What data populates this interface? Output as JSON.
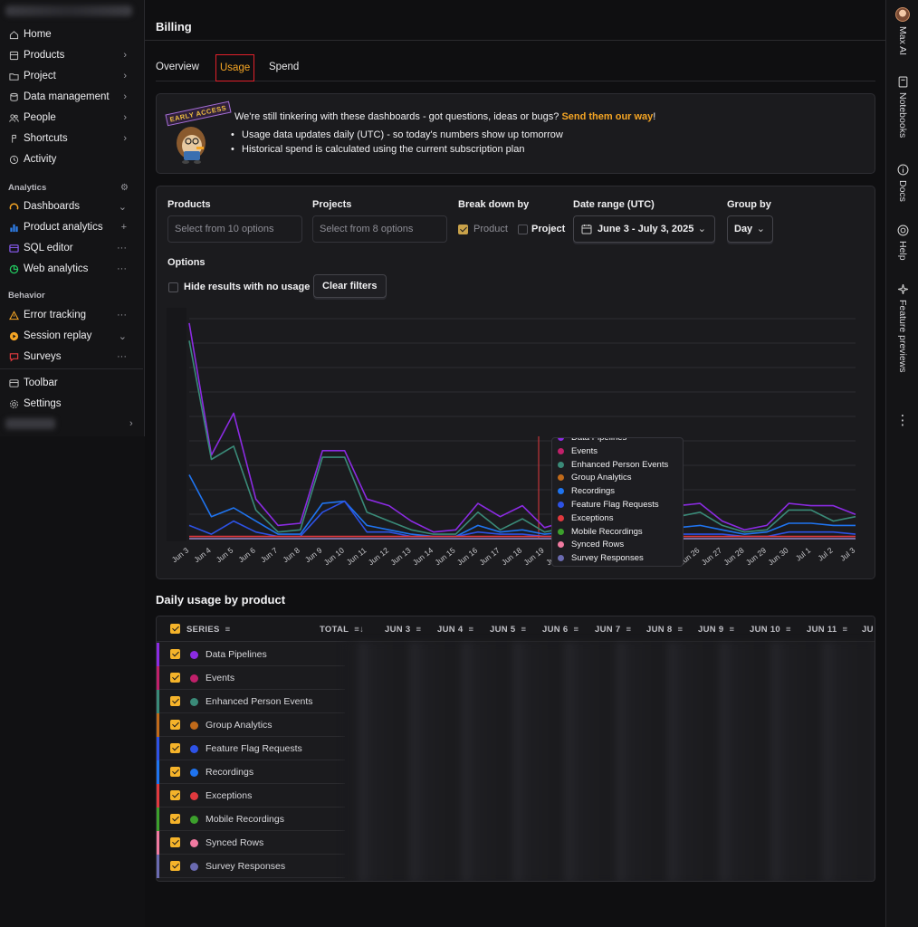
{
  "sidebar": {
    "items": [
      {
        "label": "Home"
      },
      {
        "label": "Products",
        "trail": "›"
      },
      {
        "label": "Project",
        "trail": "›"
      },
      {
        "label": "Data management",
        "trail": "›"
      },
      {
        "label": "People",
        "trail": "›"
      },
      {
        "label": "Shortcuts",
        "trail": "›"
      },
      {
        "label": "Activity"
      }
    ],
    "analytics_label": "Analytics",
    "analytics": [
      {
        "label": "Dashboards",
        "trail": "⌄"
      },
      {
        "label": "Product analytics",
        "trail": "+"
      },
      {
        "label": "SQL editor",
        "trail": "···"
      },
      {
        "label": "Web analytics",
        "trail": "···"
      }
    ],
    "behavior_label": "Behavior",
    "behavior": [
      {
        "label": "Error tracking",
        "trail": "···"
      },
      {
        "label": "Session replay",
        "trail": "⌄"
      },
      {
        "label": "Surveys",
        "trail": "···"
      }
    ],
    "bottom": [
      {
        "label": "Toolbar"
      },
      {
        "label": "Settings"
      }
    ],
    "user_trail": "›"
  },
  "rail": {
    "max_ai": "Max AI",
    "notebooks": "Notebooks",
    "docs": "Docs",
    "help": "Help",
    "feature_previews": "Feature previews",
    "more": "⋮"
  },
  "page": {
    "title": "Billing"
  },
  "tabs": [
    {
      "label": "Overview"
    },
    {
      "label": "Usage"
    },
    {
      "label": "Spend"
    }
  ],
  "banner": {
    "badge": "EARLY ACCESS",
    "headline": "We're still tinkering with these dashboards - got questions, ideas or bugs?",
    "link": "Send them our way",
    "after_link": "!",
    "bullets": [
      "Usage data updates daily (UTC) - so today's numbers show up tomorrow",
      "Historical spend is calculated using the current subscription plan"
    ]
  },
  "filters": {
    "products_label": "Products",
    "products_placeholder": "Select from 10 options",
    "projects_label": "Projects",
    "projects_placeholder": "Select from 8 options",
    "breakdown_label": "Break down by",
    "breakdown_product": "Product",
    "breakdown_project": "Project",
    "date_label": "Date range (UTC)",
    "date_value": "June 3 - July 3, 2025",
    "group_label": "Group by",
    "group_value": "Day",
    "options_label": "Options",
    "hide_no_usage": "Hide results with no usage",
    "clear_filters": "Clear filters"
  },
  "chart_data": {
    "type": "line",
    "categories": [
      "Jun 3",
      "Jun 4",
      "Jun 5",
      "Jun 6",
      "Jun 7",
      "Jun 8",
      "Jun 9",
      "Jun 10",
      "Jun 11",
      "Jun 12",
      "Jun 13",
      "Jun 14",
      "Jun 15",
      "Jun 16",
      "Jun 17",
      "Jun 18",
      "Jun 19",
      "Jun 20",
      "Jun 21",
      "Jun 22",
      "Jun 23",
      "Jun 24",
      "Jun 25",
      "Jun 26",
      "Jun 27",
      "Jun 28",
      "Jun 29",
      "Jun 30",
      "Jul 1",
      "Jul 2",
      "Jul 3"
    ],
    "ylim": [
      0,
      100
    ],
    "grid": true,
    "legend_position": "hover-tooltip",
    "series": [
      {
        "name": "Data Pipelines",
        "color": "#8b2be2",
        "values": [
          98,
          38,
          57,
          18,
          6,
          7,
          40,
          40,
          18,
          15,
          8,
          3,
          4,
          16,
          10,
          15,
          5,
          8,
          12,
          18,
          20,
          14,
          15,
          16,
          8,
          4,
          6,
          16,
          15,
          15,
          11
        ]
      },
      {
        "name": "Events",
        "color": "#c0206a",
        "values": [
          0,
          0,
          0,
          0,
          0,
          0,
          0,
          0,
          0,
          0,
          0,
          0,
          0,
          0,
          0,
          0,
          0,
          0,
          0,
          0,
          0,
          0,
          0,
          0,
          0,
          0,
          0,
          0,
          0,
          0,
          0
        ]
      },
      {
        "name": "Enhanced Person Events",
        "color": "#3a8a78",
        "values": [
          90,
          36,
          42,
          13,
          3,
          4,
          37,
          37,
          12,
          8,
          4,
          2,
          2,
          12,
          4,
          9,
          3,
          5,
          8,
          10,
          12,
          10,
          10,
          12,
          6,
          3,
          4,
          13,
          13,
          8,
          10
        ]
      },
      {
        "name": "Group Analytics",
        "color": "#c06a1a",
        "values": [
          0,
          0,
          0,
          0,
          0,
          0,
          0,
          0,
          0,
          0,
          0,
          0,
          0,
          0,
          0,
          0,
          0,
          0,
          0,
          0,
          0,
          0,
          0,
          0,
          0,
          0,
          0,
          0,
          0,
          0,
          0
        ]
      },
      {
        "name": "Recordings",
        "color": "#1f74f0",
        "values": [
          29,
          10,
          14,
          8,
          2,
          2,
          16,
          17,
          6,
          4,
          2,
          1,
          1,
          6,
          3,
          4,
          2,
          3,
          4,
          5,
          6,
          5,
          5,
          6,
          4,
          2,
          3,
          7,
          7,
          6,
          6
        ]
      },
      {
        "name": "Feature Flag Requests",
        "color": "#2d52e6",
        "values": [
          6,
          2,
          8,
          3,
          1,
          1,
          12,
          17,
          3,
          3,
          1,
          1,
          1,
          3,
          2,
          2,
          1,
          1,
          2,
          2,
          2,
          2,
          2,
          2,
          2,
          1,
          1,
          3,
          3,
          3,
          2
        ]
      },
      {
        "name": "Exceptions",
        "color": "#e0393e",
        "values": [
          1,
          1,
          1,
          1,
          1,
          1,
          1,
          1,
          1,
          1,
          1,
          1,
          1,
          1,
          1,
          1,
          1,
          1,
          1,
          1,
          1,
          1,
          1,
          1,
          1,
          1,
          1,
          1,
          1,
          1,
          1
        ]
      },
      {
        "name": "Mobile Recordings",
        "color": "#3ca02c",
        "values": [
          0,
          0,
          0,
          0,
          0,
          0,
          0,
          0,
          0,
          0,
          0,
          0,
          0,
          0,
          0,
          0,
          0,
          0,
          0,
          0,
          0,
          0,
          0,
          0,
          0,
          0,
          0,
          0,
          0,
          0,
          0
        ]
      },
      {
        "name": "Synced Rows",
        "color": "#f07aa0",
        "values": [
          0,
          0,
          0,
          0,
          0,
          0,
          0,
          0,
          0,
          0,
          0,
          0,
          0,
          0,
          0,
          0,
          0,
          0,
          0,
          0,
          0,
          0,
          0,
          0,
          0,
          0,
          0,
          0,
          0,
          0,
          0
        ]
      },
      {
        "name": "Survey Responses",
        "color": "#6a6ab0",
        "values": [
          0,
          0,
          0,
          0,
          0,
          0,
          0,
          0,
          0,
          0,
          0,
          0,
          0,
          0,
          0,
          0,
          0,
          0,
          0,
          0,
          0,
          0,
          0,
          0,
          0,
          0,
          0,
          0,
          0,
          0,
          0
        ]
      }
    ],
    "tooltip_items": [
      "Data Pipelines",
      "Events",
      "Enhanced Person Events",
      "Group Analytics",
      "Recordings",
      "Feature Flag Requests",
      "Exceptions",
      "Mobile Recordings",
      "Synced Rows",
      "Survey Responses"
    ]
  },
  "table": {
    "title": "Daily usage by product",
    "headers": [
      "SERIES",
      "TOTAL",
      "JUN 3",
      "JUN 4",
      "JUN 5",
      "JUN 6",
      "JUN 7",
      "JUN 8",
      "JUN 9",
      "JUN 10",
      "JUN 11",
      "JU"
    ],
    "rows": [
      {
        "label": "Data Pipelines",
        "color": "#8b2be2"
      },
      {
        "label": "Events",
        "color": "#c0206a"
      },
      {
        "label": "Enhanced Person Events",
        "color": "#3a8a78"
      },
      {
        "label": "Group Analytics",
        "color": "#c06a1a"
      },
      {
        "label": "Feature Flag Requests",
        "color": "#2d52e6"
      },
      {
        "label": "Recordings",
        "color": "#1f74f0"
      },
      {
        "label": "Exceptions",
        "color": "#e0393e"
      },
      {
        "label": "Mobile Recordings",
        "color": "#3ca02c"
      },
      {
        "label": "Synced Rows",
        "color": "#f07aa0"
      },
      {
        "label": "Survey Responses",
        "color": "#6a6ab0"
      }
    ]
  }
}
